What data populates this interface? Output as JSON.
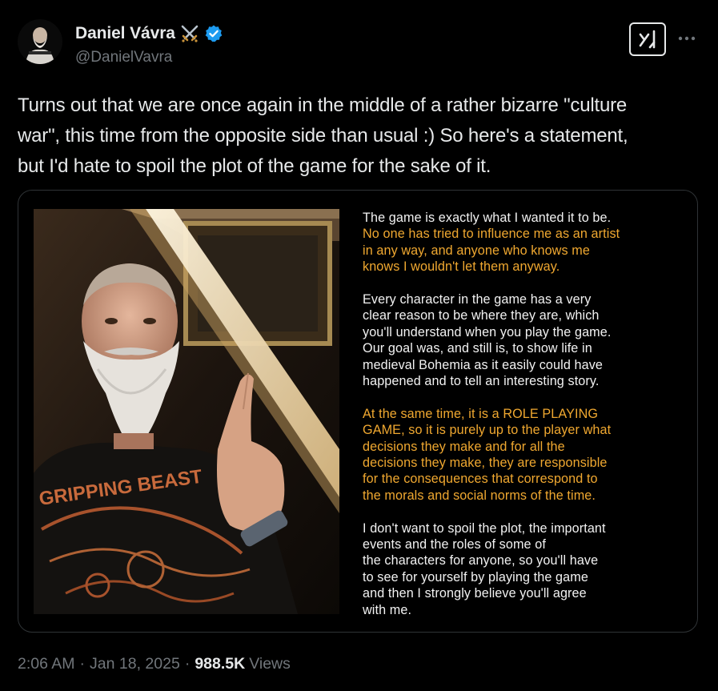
{
  "author": {
    "display_name": "Daniel Vávra",
    "handle": "@DanielVavra",
    "name_emoji": "crossed-swords-icon",
    "verified": true
  },
  "tweet": {
    "text": "Turns out that we are once again in the middle of a rather bizarre \"culture\nwar\", this time from the opposite side than usual :) So here's a statement,\nbut I'd hate to spoil the plot of the game for the sake of it."
  },
  "media": {
    "statement": [
      {
        "white": "The game is exactly what I wanted it to be.",
        "gold": "No one has tried to influence me as an artist\nin any way, and anyone who knows me\nknows I wouldn't let them anyway."
      },
      {
        "white": "Every character in the game has a very\nclear reason to be where they are, which\nyou'll understand when you play the game.\nOur goal was, and still is, to show life in\nmedieval Bohemia as it easily could have\nhappened and to tell an interesting story."
      },
      {
        "gold": "At the same time, it is a ROLE PLAYING\nGAME, so it is purely up to the player what\ndecisions they make and for all the\ndecisions they make, they are responsible\nfor the consequences that correspond to\nthe morals and social norms of the time."
      },
      {
        "white": "I don't want to spoil the plot, the important\nevents and the roles of some of\nthe characters for anyone, so you'll have\nto see for yourself by playing the game\nand then I strongly believe you'll agree\nwith me."
      }
    ],
    "shirt_text": "GRIPPING BEAST"
  },
  "footer": {
    "time": "2:06 AM",
    "date": "Jan 18, 2025",
    "views_count": "988.5K",
    "views_label": "Views",
    "separator": "·"
  },
  "colors": {
    "background": "#000000",
    "text_primary": "#e7e9ea",
    "text_secondary": "#71767b",
    "verified_blue": "#1d9bf0",
    "statement_gold": "#f0a830",
    "card_border": "#2f3336"
  }
}
